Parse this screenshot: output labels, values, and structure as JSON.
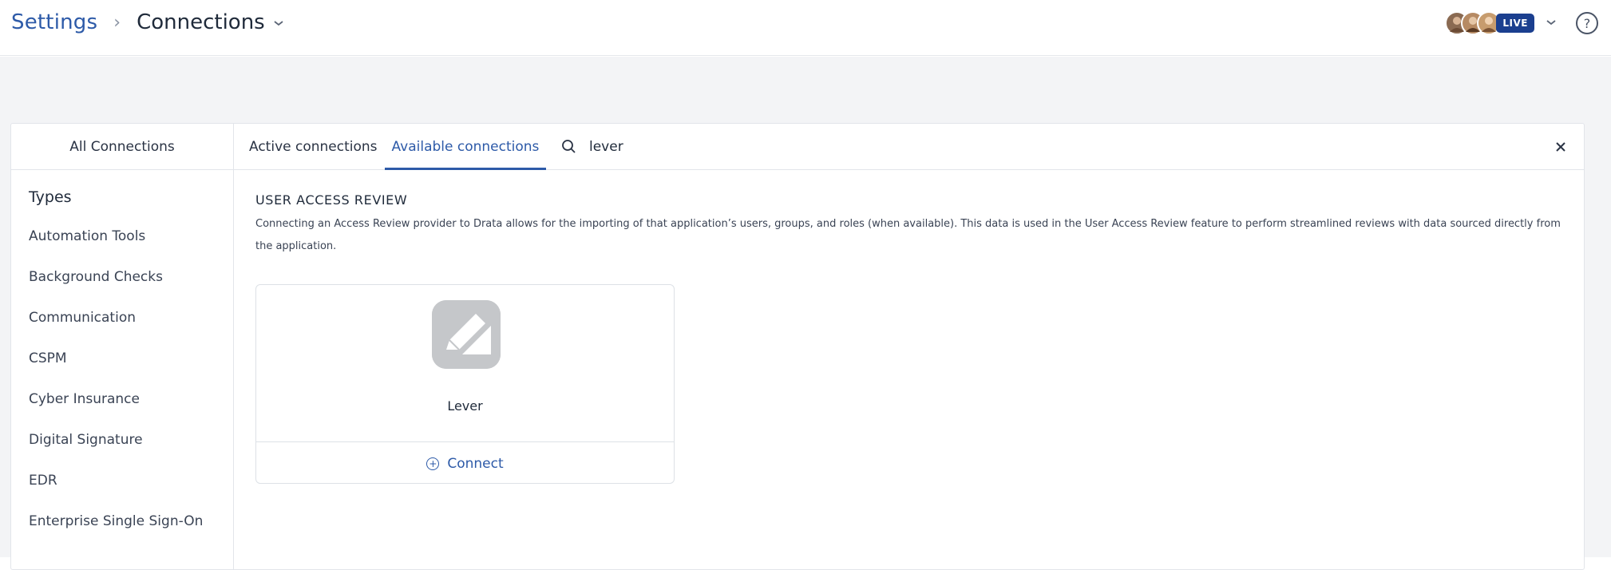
{
  "header": {
    "breadcrumb_root": "Settings",
    "breadcrumb_separator": "›",
    "breadcrumb_current": "Connections",
    "live_badge": "LIVE",
    "help_icon": "help-circle-icon"
  },
  "panel": {
    "all_connections_label": "All Connections",
    "tabs": [
      {
        "label": "Active connections",
        "active": false
      },
      {
        "label": "Available connections",
        "active": true
      }
    ],
    "search": {
      "value": "lever",
      "icon": "search-icon"
    },
    "close_icon": "close-icon"
  },
  "sidebar": {
    "title": "Types",
    "items": [
      "Automation Tools",
      "Background Checks",
      "Communication",
      "CSPM",
      "Cyber Insurance",
      "Digital Signature",
      "EDR",
      "Enterprise Single Sign-On"
    ]
  },
  "section": {
    "title": "USER ACCESS REVIEW",
    "description": "Connecting an Access Review provider to Drata allows for the importing of that application’s users, groups, and roles (when available). This data is used in the User Access Review feature to perform streamlined reviews with data sourced directly from the application."
  },
  "card": {
    "name": "Lever",
    "connect_label": "Connect"
  },
  "colors": {
    "accent": "#2d5aa8",
    "live_badge_bg": "#1b3f8f",
    "page_band": "#f3f4f6"
  }
}
